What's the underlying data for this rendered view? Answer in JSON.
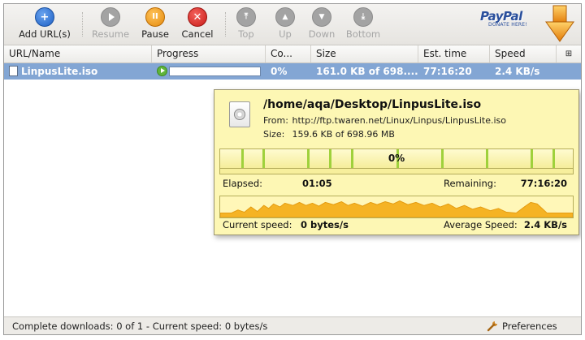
{
  "toolbar": {
    "buttons": [
      {
        "label": "Add URL(s)",
        "icon": "add-icon",
        "enabled": true
      },
      {
        "label": "Resume",
        "icon": "play-icon",
        "enabled": false
      },
      {
        "label": "Pause",
        "icon": "pause-icon",
        "enabled": true
      },
      {
        "label": "Cancel",
        "icon": "cancel-icon",
        "enabled": true
      },
      {
        "label": "Top",
        "icon": "move-top-icon",
        "enabled": false
      },
      {
        "label": "Up",
        "icon": "move-up-icon",
        "enabled": false
      },
      {
        "label": "Down",
        "icon": "move-down-icon",
        "enabled": false
      },
      {
        "label": "Bottom",
        "icon": "move-bottom-icon",
        "enabled": false
      }
    ],
    "paypal_logo": "PayPal",
    "paypal_sub": "DONATE HERE!"
  },
  "table": {
    "columns": [
      "URL/Name",
      "Progress",
      "Co...",
      "Size",
      "Est. time",
      "Speed"
    ],
    "rows": [
      {
        "name": "LinpusLite.iso",
        "progress": 0,
        "completed": "0%",
        "size": "161.0 KB of 698....",
        "est_time": "77:16:20",
        "speed": "2.4 KB/s"
      }
    ]
  },
  "popup": {
    "path": "/home/aqa/Desktop/LinpusLite.iso",
    "from_label": "From:",
    "from_value": "http://ftp.twaren.net/Linux/Linpus/LinpusLite.iso",
    "size_label": "Size:",
    "size_value": "159.6 KB of 698.96 MB",
    "percent": "0%",
    "elapsed_label": "Elapsed:",
    "elapsed_value": "01:05",
    "remaining_label": "Remaining:",
    "remaining_value": "77:16:20",
    "current_speed_label": "Current speed:",
    "current_speed_value": "0 bytes/s",
    "average_speed_label": "Average Speed:",
    "average_speed_value": "2.4 KB/s"
  },
  "statusbar": {
    "text": "Complete downloads: 0 of 1 - Current speed: 0 bytes/s",
    "preferences_label": "Preferences"
  },
  "colors": {
    "selection": "#83a6d4",
    "popup_bg": "#fdf7b4",
    "segment_green": "#9fd13c",
    "graph_orange": "#f5b324"
  }
}
